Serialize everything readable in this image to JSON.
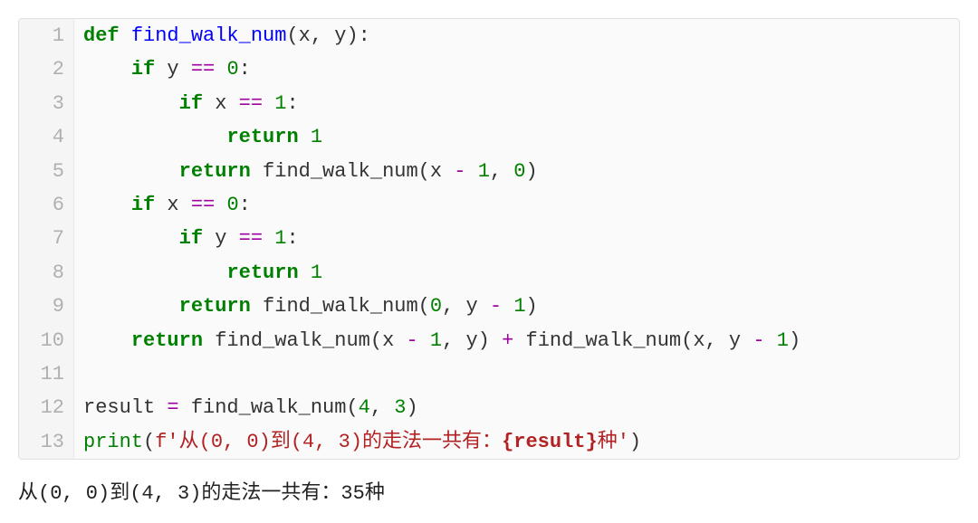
{
  "code": {
    "lines": [
      {
        "n": "1",
        "tokens": [
          {
            "cls": "kw",
            "t": "def"
          },
          {
            "cls": "plain",
            "t": " "
          },
          {
            "cls": "fn",
            "t": "find_walk_num"
          },
          {
            "cls": "plain",
            "t": "(x, y):"
          }
        ]
      },
      {
        "n": "2",
        "tokens": [
          {
            "cls": "plain",
            "t": "    "
          },
          {
            "cls": "kw",
            "t": "if"
          },
          {
            "cls": "plain",
            "t": " y "
          },
          {
            "cls": "op",
            "t": "=="
          },
          {
            "cls": "plain",
            "t": " "
          },
          {
            "cls": "num",
            "t": "0"
          },
          {
            "cls": "plain",
            "t": ":"
          }
        ]
      },
      {
        "n": "3",
        "tokens": [
          {
            "cls": "plain",
            "t": "        "
          },
          {
            "cls": "kw",
            "t": "if"
          },
          {
            "cls": "plain",
            "t": " x "
          },
          {
            "cls": "op",
            "t": "=="
          },
          {
            "cls": "plain",
            "t": " "
          },
          {
            "cls": "num",
            "t": "1"
          },
          {
            "cls": "plain",
            "t": ":"
          }
        ]
      },
      {
        "n": "4",
        "tokens": [
          {
            "cls": "plain",
            "t": "            "
          },
          {
            "cls": "kw",
            "t": "return"
          },
          {
            "cls": "plain",
            "t": " "
          },
          {
            "cls": "num",
            "t": "1"
          }
        ]
      },
      {
        "n": "5",
        "tokens": [
          {
            "cls": "plain",
            "t": "        "
          },
          {
            "cls": "kw",
            "t": "return"
          },
          {
            "cls": "plain",
            "t": " find_walk_num(x "
          },
          {
            "cls": "op",
            "t": "-"
          },
          {
            "cls": "plain",
            "t": " "
          },
          {
            "cls": "num",
            "t": "1"
          },
          {
            "cls": "plain",
            "t": ", "
          },
          {
            "cls": "num",
            "t": "0"
          },
          {
            "cls": "plain",
            "t": ")"
          }
        ]
      },
      {
        "n": "6",
        "tokens": [
          {
            "cls": "plain",
            "t": "    "
          },
          {
            "cls": "kw",
            "t": "if"
          },
          {
            "cls": "plain",
            "t": " x "
          },
          {
            "cls": "op",
            "t": "=="
          },
          {
            "cls": "plain",
            "t": " "
          },
          {
            "cls": "num",
            "t": "0"
          },
          {
            "cls": "plain",
            "t": ":"
          }
        ]
      },
      {
        "n": "7",
        "tokens": [
          {
            "cls": "plain",
            "t": "        "
          },
          {
            "cls": "kw",
            "t": "if"
          },
          {
            "cls": "plain",
            "t": " y "
          },
          {
            "cls": "op",
            "t": "=="
          },
          {
            "cls": "plain",
            "t": " "
          },
          {
            "cls": "num",
            "t": "1"
          },
          {
            "cls": "plain",
            "t": ":"
          }
        ]
      },
      {
        "n": "8",
        "tokens": [
          {
            "cls": "plain",
            "t": "            "
          },
          {
            "cls": "kw",
            "t": "return"
          },
          {
            "cls": "plain",
            "t": " "
          },
          {
            "cls": "num",
            "t": "1"
          }
        ]
      },
      {
        "n": "9",
        "tokens": [
          {
            "cls": "plain",
            "t": "        "
          },
          {
            "cls": "kw",
            "t": "return"
          },
          {
            "cls": "plain",
            "t": " find_walk_num("
          },
          {
            "cls": "num",
            "t": "0"
          },
          {
            "cls": "plain",
            "t": ", y "
          },
          {
            "cls": "op",
            "t": "-"
          },
          {
            "cls": "plain",
            "t": " "
          },
          {
            "cls": "num",
            "t": "1"
          },
          {
            "cls": "plain",
            "t": ")"
          }
        ]
      },
      {
        "n": "10",
        "tokens": [
          {
            "cls": "plain",
            "t": "    "
          },
          {
            "cls": "kw",
            "t": "return"
          },
          {
            "cls": "plain",
            "t": " find_walk_num(x "
          },
          {
            "cls": "op",
            "t": "-"
          },
          {
            "cls": "plain",
            "t": " "
          },
          {
            "cls": "num",
            "t": "1"
          },
          {
            "cls": "plain",
            "t": ", y) "
          },
          {
            "cls": "op",
            "t": "+"
          },
          {
            "cls": "plain",
            "t": " find_walk_num(x, y "
          },
          {
            "cls": "op",
            "t": "-"
          },
          {
            "cls": "plain",
            "t": " "
          },
          {
            "cls": "num",
            "t": "1"
          },
          {
            "cls": "plain",
            "t": ")"
          }
        ]
      },
      {
        "n": "11",
        "tokens": []
      },
      {
        "n": "12",
        "tokens": [
          {
            "cls": "plain",
            "t": "result "
          },
          {
            "cls": "op",
            "t": "="
          },
          {
            "cls": "plain",
            "t": " find_walk_num("
          },
          {
            "cls": "num",
            "t": "4"
          },
          {
            "cls": "plain",
            "t": ", "
          },
          {
            "cls": "num",
            "t": "3"
          },
          {
            "cls": "plain",
            "t": ")"
          }
        ]
      },
      {
        "n": "13",
        "tokens": [
          {
            "cls": "builtin",
            "t": "print"
          },
          {
            "cls": "plain",
            "t": "("
          },
          {
            "cls": "str",
            "t": "f'从(0, 0)到(4, 3)的走法一共有："
          },
          {
            "cls": "interp",
            "t": "{result}"
          },
          {
            "cls": "str",
            "t": "种'"
          },
          {
            "cls": "plain",
            "t": ")"
          }
        ]
      }
    ]
  },
  "output": "从(0, 0)到(4, 3)的走法一共有：35种"
}
